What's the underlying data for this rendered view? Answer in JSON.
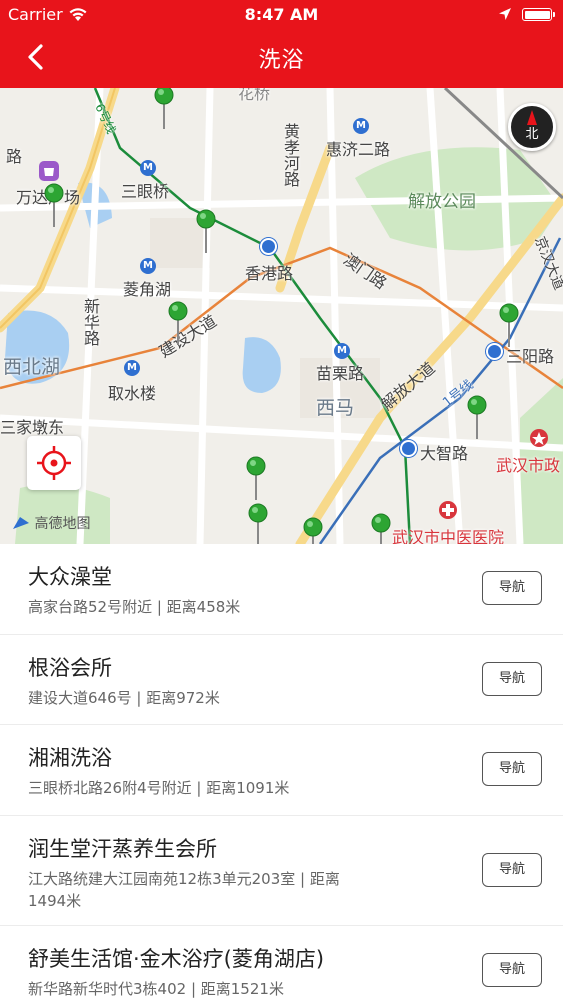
{
  "status_bar": {
    "carrier": "Carrier",
    "time": "8:47 AM"
  },
  "nav": {
    "title": "洗浴",
    "back_icon": "chevron-left-icon"
  },
  "colors": {
    "brand": "#e8141b",
    "metro": "#2f6fd0",
    "pin": "#2da533"
  },
  "map": {
    "compass_label": "北",
    "provider": "高德地图",
    "labels": {
      "sanyanqiao": "三眼桥",
      "huijier": "惠济二路",
      "jiefang_park": "解放公园",
      "xianggang": "香港路",
      "lingjiaohu": "菱角湖",
      "xinhua": "新华路",
      "jianshe": "建设大道",
      "xibeihu": "西北湖",
      "qushuilou": "取水楼",
      "sanjia": "三家墩东",
      "miaoli": "苗栗路",
      "xima": "西马",
      "jiefang_rd": "解放大道",
      "line1": "1号线",
      "dazhi": "大智路",
      "sanyang": "三阳路",
      "wuhan_station": "武汉市政",
      "hospital": "武汉市中医医院",
      "huangxiaohe": "黄孝河路",
      "aomen": "澳门路",
      "wanda": "万达广场",
      "jingfa": "京汉大道",
      "huaqiao": "花桥",
      "line6": "6号线",
      "shuiliu": "路"
    }
  },
  "places": [
    {
      "name": "大众澡堂",
      "detail": "高家台路52号附近 | 距离458米",
      "button": "导航"
    },
    {
      "name": "根浴会所",
      "detail": "建设大道646号 | 距离972米",
      "button": "导航"
    },
    {
      "name": "湘湘洗浴",
      "detail": "三眼桥北路26附4号附近 | 距离1091米",
      "button": "导航"
    },
    {
      "name": "润生堂汗蒸养生会所",
      "detail": "江大路统建大江园南苑12栋3单元203室 | 距离1494米",
      "button": "导航"
    },
    {
      "name": "舒美生活馆·金木浴疗(菱角湖店)",
      "detail": "新华路新华时代3栋402 | 距离1521米",
      "button": "导航"
    }
  ]
}
